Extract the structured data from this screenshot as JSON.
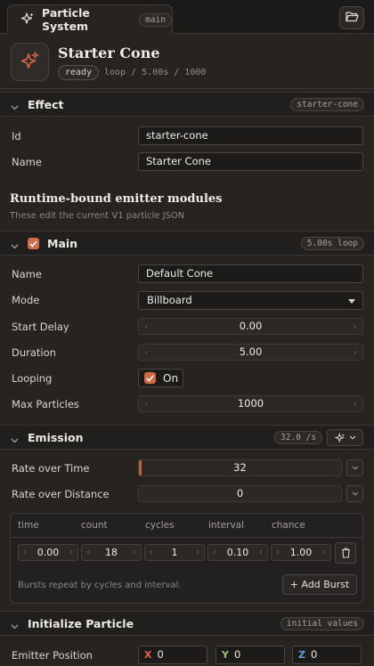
{
  "tab": {
    "title": "Particle System",
    "tag": "main"
  },
  "header": {
    "title": "Starter Cone",
    "status": "ready",
    "meta": "loop / 5.00s / 1000"
  },
  "effect": {
    "title": "Effect",
    "tag": "starter-cone",
    "id_label": "Id",
    "id_value": "starter-cone",
    "name_label": "Name",
    "name_value": "Starter Cone"
  },
  "runtime": {
    "title": "Runtime-bound emitter modules",
    "note": "These edit the current V1 particle JSON"
  },
  "main": {
    "title": "Main",
    "tag": "5.00s loop",
    "enabled": true,
    "rows": {
      "name_label": "Name",
      "name_value": "Default Cone",
      "mode_label": "Mode",
      "mode_value": "Billboard",
      "start_delay_label": "Start Delay",
      "start_delay_value": "0.00",
      "duration_label": "Duration",
      "duration_value": "5.00",
      "looping_label": "Looping",
      "looping_value": "On",
      "max_particles_label": "Max Particles",
      "max_particles_value": "1000"
    }
  },
  "emission": {
    "title": "Emission",
    "tag": "32.0 /s",
    "rate_time_label": "Rate over Time",
    "rate_time_value": "32",
    "rate_distance_label": "Rate over Distance",
    "rate_distance_value": "0",
    "bursts": {
      "headers": [
        "time",
        "count",
        "cycles",
        "interval",
        "chance"
      ],
      "row": [
        "0.00",
        "18",
        "1",
        "0.10",
        "1.00"
      ],
      "note": "Bursts repeat by cycles and interval.",
      "add_label": "+ Add Burst"
    }
  },
  "initialize": {
    "title": "Initialize Particle",
    "tag": "initial values",
    "emitter_position_label": "Emitter Position",
    "x_label": "X",
    "x_value": "0",
    "y_label": "Y",
    "y_value": "0",
    "z_label": "Z",
    "z_value": "0"
  },
  "colors": {
    "accent": "#d16a48",
    "axis_x": "#e0604a",
    "axis_y": "#8fc46b",
    "axis_z": "#5f9be0",
    "background": "#262321"
  },
  "icons": [
    "sparkles-icon",
    "folder-open-icon",
    "chevron-down-icon",
    "check-icon",
    "trash-icon"
  ]
}
